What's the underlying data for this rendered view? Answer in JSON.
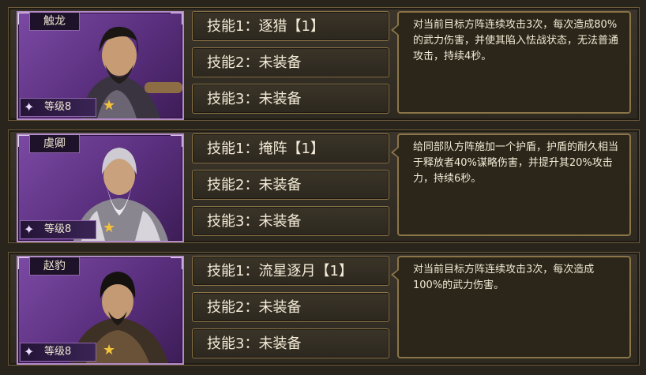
{
  "generals": [
    {
      "name": "触龙",
      "level": "等级8",
      "skills": [
        "技能1：逐猎【1】",
        "技能2：未装备",
        "技能3：未装备"
      ],
      "description": "对当前目标方阵连续攻击3次，每次造成80%的武力伤害，并使其陷入怯战状态，无法普通攻击，持续4秒。"
    },
    {
      "name": "虞卿",
      "level": "等级8",
      "skills": [
        "技能1：掩阵【1】",
        "技能2：未装备",
        "技能3：未装备"
      ],
      "description": "给同部队方阵施加一个护盾，护盾的耐久相当于释放者40%谋略伤害，并提升其20%攻击力，持续6秒。"
    },
    {
      "name": "赵豹",
      "level": "等级8",
      "skills": [
        "技能1：流星逐月【1】",
        "技能2：未装备",
        "技能3：未装备"
      ],
      "description": "对当前目标方阵连续攻击3次，每次造成100%的武力伤害。"
    }
  ],
  "icons": {
    "rank_badge": "rank-badge-icon",
    "star": "star-icon"
  },
  "colors": {
    "portrait_purple": "#6a3a92",
    "border_gold": "#8b7448",
    "star_gold": "#f2c23a",
    "text": "#f3ead6"
  }
}
